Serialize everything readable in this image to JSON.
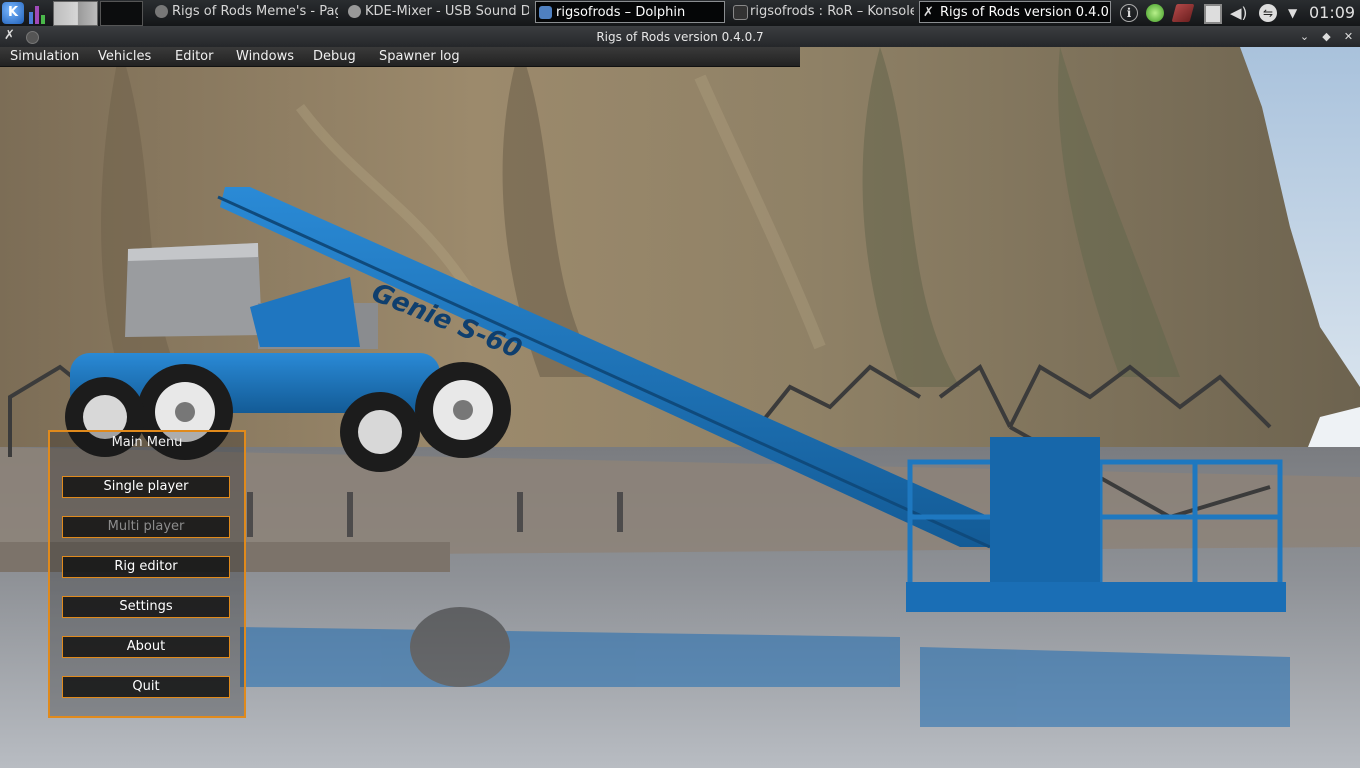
{
  "taskbar": {
    "launcher_icon": "kde-k-menu-icon",
    "tasks": [
      {
        "label": "Rigs of Rods Meme's - Pag",
        "icon": "browser-icon"
      },
      {
        "label": "KDE-Mixer - USB Sound De",
        "icon": "mixer-icon"
      },
      {
        "label": "rigsofrods – Dolphin",
        "icon": "folder-icon"
      },
      {
        "label": "rigsofrods : RoR – Konsole",
        "icon": "terminal-icon"
      },
      {
        "label": "Rigs of Rods version 0.4.0",
        "icon": "ror-icon"
      }
    ],
    "clock": "01:09"
  },
  "window": {
    "title": "Rigs of Rods version 0.4.0.7",
    "buttons": {
      "minimize": "⌄",
      "maximize": "◆",
      "close": "✕"
    }
  },
  "menubar": {
    "items": [
      "Simulation",
      "Vehicles",
      "Editor",
      "Windows",
      "Debug",
      "Spawner log"
    ]
  },
  "main_menu": {
    "title": "Main Menu",
    "buttons": [
      {
        "label": "Single player",
        "enabled": true
      },
      {
        "label": "Multi player",
        "enabled": false
      },
      {
        "label": "Rig editor",
        "enabled": true
      },
      {
        "label": "Settings",
        "enabled": true
      },
      {
        "label": "About",
        "enabled": true
      },
      {
        "label": "Quit",
        "enabled": true
      }
    ]
  },
  "scene": {
    "vehicle_brand_text": "Genie S-60",
    "colors": {
      "accent_orange": "#e08a1c",
      "vehicle_blue": "#1e78c0",
      "cliff": "#8a7a60",
      "water": "#6a7078"
    }
  }
}
